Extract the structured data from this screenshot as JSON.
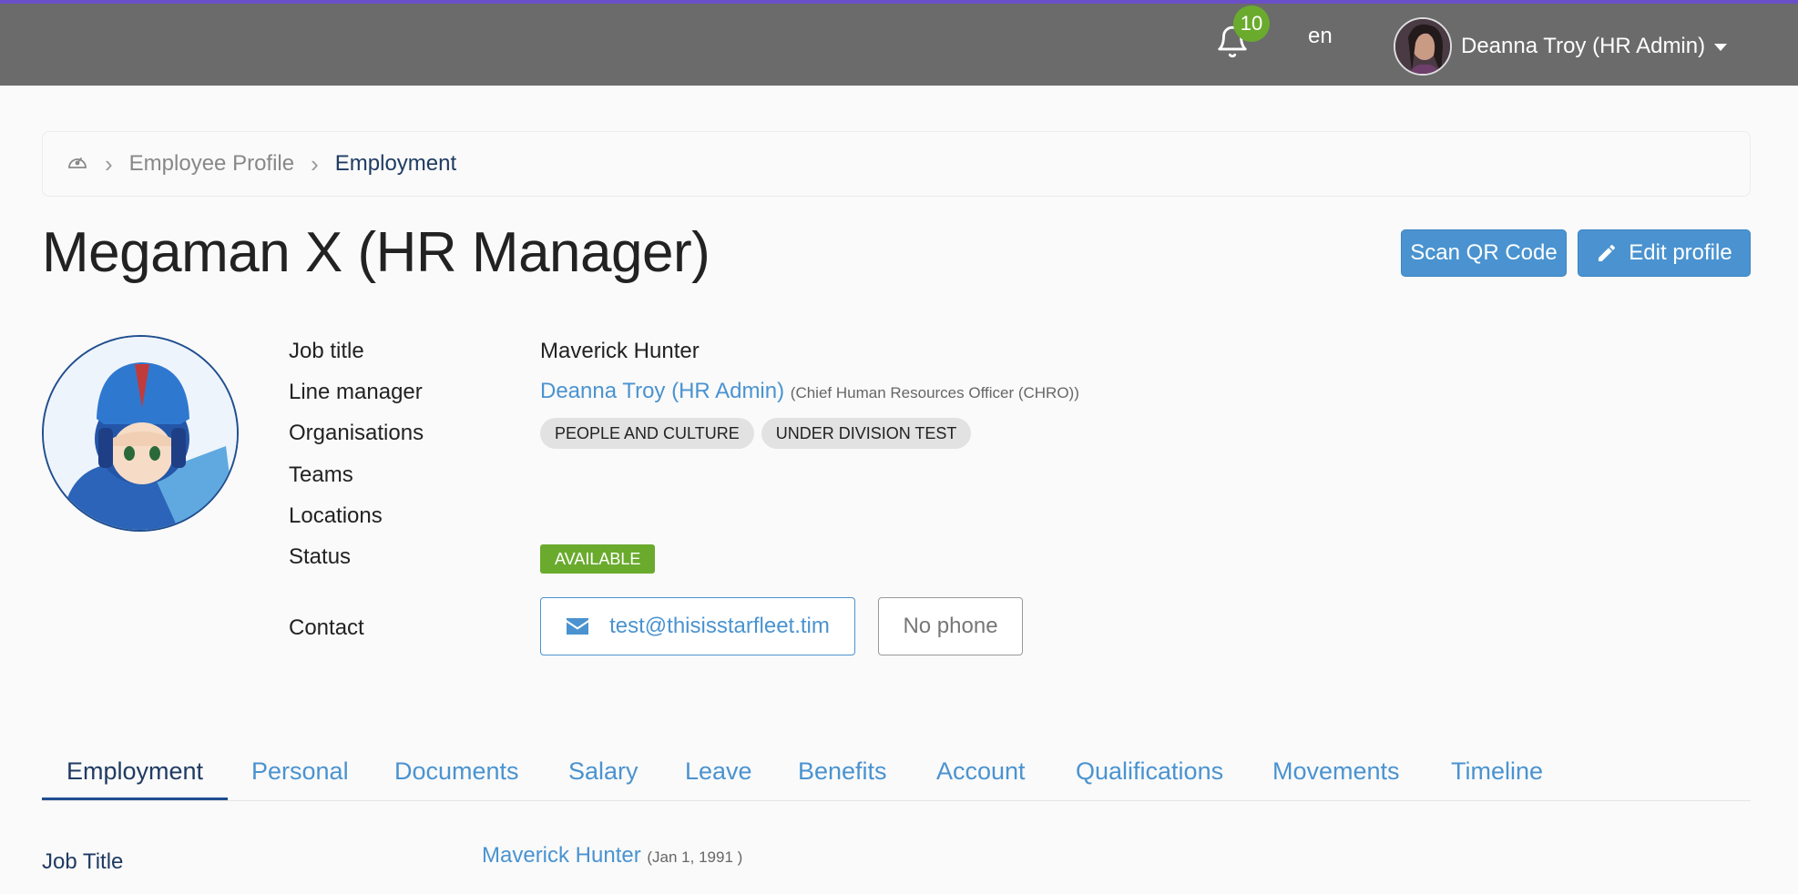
{
  "header": {
    "notifications_count": "10",
    "language": "en",
    "user_name": "Deanna Troy (HR Admin)"
  },
  "breadcrumb": {
    "items": [
      "Employee Profile",
      "Employment"
    ]
  },
  "profile": {
    "title": "Megaman X (HR Manager)",
    "actions": {
      "scan_qr": "Scan QR Code",
      "edit": "Edit profile"
    },
    "fields": {
      "job_title_label": "Job title",
      "job_title_value": "Maverick Hunter",
      "line_manager_label": "Line manager",
      "line_manager_name": "Deanna Troy (HR Admin)",
      "line_manager_role": "(Chief Human Resources Officer (CHRO))",
      "organisations_label": "Organisations",
      "organisations": [
        "PEOPLE AND CULTURE",
        "UNDER DIVISION TEST"
      ],
      "teams_label": "Teams",
      "locations_label": "Locations",
      "status_label": "Status",
      "status_value": "AVAILABLE",
      "contact_label": "Contact",
      "email": "test@thisisstarfleet.tim",
      "phone": "No phone"
    }
  },
  "tabs": [
    "Employment",
    "Personal",
    "Documents",
    "Salary",
    "Leave",
    "Benefits",
    "Account",
    "Qualifications",
    "Movements",
    "Timeline"
  ],
  "employment": {
    "job_title_label": "Job Title",
    "job_title_value": "Maverick Hunter",
    "job_title_date": "(Jan 1, 1991 )"
  },
  "colors": {
    "topbar": "#6b6b6b",
    "accent": "#4a93d0",
    "success": "#6aab2e"
  }
}
